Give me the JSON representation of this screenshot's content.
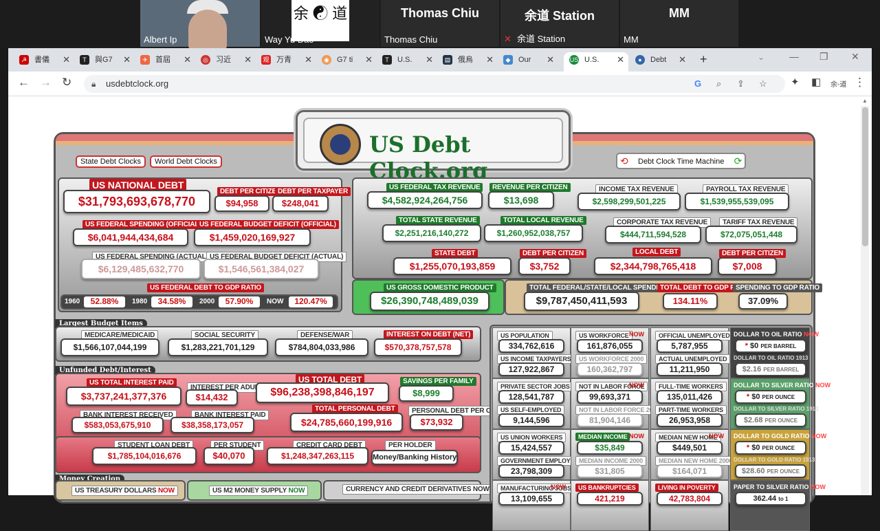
{
  "meeting": {
    "tiles": [
      {
        "name": "Albert Ip",
        "big": ""
      },
      {
        "name": "Way Yu Dao",
        "big": "余 ☯ 道"
      },
      {
        "name": "Thomas Chiu",
        "big": "Thomas Chiu"
      },
      {
        "name": "余道 Station",
        "big": "余道 Station"
      },
      {
        "name": "MM",
        "big": "MM"
      }
    ]
  },
  "browser": {
    "tabs": [
      "書儀",
      "與G7",
      "首屆",
      "习近",
      "万青",
      "G7 ti",
      "U.S.",
      "俄烏",
      "Our",
      "U.S.",
      "Debt"
    ],
    "url": "usdebtclock.org"
  },
  "brand": "US Debt Clock.org",
  "buttons": {
    "state": "State Debt Clocks",
    "world": "World Debt Clocks",
    "time_machine": "Debt Clock Time Machine"
  },
  "national": {
    "title": "US NATIONAL DEBT",
    "value": "$31,793,693,678,770",
    "per_citizen_label": "DEBT PER CITIZEN",
    "per_citizen": "$94,958",
    "per_taxpayer_label": "DEBT PER TAXPAYER",
    "per_taxpayer": "$248,041",
    "spend_off_label": "US FEDERAL SPENDING (OFFICIAL)",
    "spend_off": "$6,041,944,434,684",
    "deficit_off_label": "US FEDERAL BUDGET DEFICIT (OFFICIAL)",
    "deficit_off": "$1,459,020,169,927",
    "spend_act_label": "US FEDERAL SPENDING (ACTUAL)",
    "spend_act": "$6,129,485,632,770",
    "deficit_act_label": "US FEDERAL BUDGET DEFICIT (ACTUAL)",
    "deficit_act": "$1,546,561,384,027",
    "gdp_ratio_label": "US FEDERAL DEBT TO GDP RATIO",
    "years": [
      {
        "y": "1960",
        "v": "52.88%"
      },
      {
        "y": "1980",
        "v": "34.58%"
      },
      {
        "y": "2000",
        "v": "57.90%"
      },
      {
        "y": "NOW",
        "v": "120.47%"
      }
    ]
  },
  "revenue": {
    "fed_label": "US FEDERAL TAX REVENUE",
    "fed": "$4,582,924,264,756",
    "rpc_label": "REVENUE PER CITIZEN",
    "rpc": "$13,698",
    "income_label": "INCOME TAX REVENUE",
    "income": "$2,598,299,501,225",
    "payroll_label": "PAYROLL TAX REVENUE",
    "payroll": "$1,539,955,539,095",
    "state_label": "TOTAL STATE REVENUE",
    "state": "$2,251,216,140,272",
    "local_label": "TOTAL LOCAL REVENUE",
    "local": "$1,260,952,038,757",
    "corp_label": "CORPORATE TAX REVENUE",
    "corp": "$444,711,594,528",
    "tariff_label": "TARIFF TAX REVENUE",
    "tariff": "$72,075,051,448",
    "sdebt_label": "STATE DEBT",
    "sdebt": "$1,255,070,193,859",
    "sdpc_label": "DEBT PER CITIZEN",
    "sdpc": "$3,752",
    "ldebt_label": "LOCAL DEBT",
    "ldebt": "$2,344,798,765,418",
    "ldpc_label": "DEBT PER CITIZEN",
    "ldpc": "$7,008",
    "gdp_label": "US GROSS DOMESTIC PRODUCT",
    "gdp": "$26,390,748,489,039",
    "tot_label": "TOTAL FEDERAL/STATE/LOCAL SPENDING",
    "tot": "$9,787,450,411,593",
    "dgdp_label": "TOTAL DEBT TO GDP RATIO",
    "dgdp": "134.11%",
    "sgdp_label": "SPENDING TO GDP RATIO",
    "sgdp": "37.09%"
  },
  "budget": {
    "title": "Largest Budget Items",
    "items": [
      {
        "l": "MEDICARE/MEDICAID",
        "v": "$1,566,107,044,199"
      },
      {
        "l": "SOCIAL SECURITY",
        "v": "$1,283,221,701,129"
      },
      {
        "l": "DEFENSE/WAR",
        "v": "$784,804,033,986"
      },
      {
        "l": "INTEREST ON DEBT (NET)",
        "v": "$570,378,757,578"
      }
    ]
  },
  "unfunded": {
    "title": "Unfunded Debt/Interest",
    "interest_paid_label": "US TOTAL INTEREST PAID",
    "interest_paid": "$3,737,241,377,376",
    "ipa_label": "INTEREST PER ADULT",
    "ipa": "$14,432",
    "total_debt_label": "US TOTAL DEBT",
    "total_debt": "$96,238,398,846,197",
    "savings_label": "SAVINGS PER FAMILY",
    "savings": "$8,999",
    "bir_label": "BANK INTEREST RECEIVED",
    "bir": "$583,053,675,910",
    "bip_label": "BANK INTEREST PAID",
    "bip": "$38,358,173,057",
    "tpd_label": "TOTAL PERSONAL DEBT",
    "tpd": "$24,785,660,199,916",
    "pdpc_label": "PERSONAL DEBT PER CIT.",
    "pdpc": "$73,932",
    "sld_label": "STUDENT LOAN DEBT",
    "sld": "$1,785,104,016,676",
    "ps_label": "PER STUDENT",
    "ps": "$40,070",
    "ccd_label": "CREDIT CARD DEBT",
    "ccd": "$1,248,347,263,115",
    "ph_label": "PER HOLDER",
    "ph": "Money/Banking History"
  },
  "money": {
    "title": "Money Creation",
    "l1": "US TREASURY DOLLARS",
    "l1b": "NOW",
    "l2": "US M2 MONEY SUPPLY",
    "l2b": "NOW",
    "l3": "CURRENCY AND CREDIT DERIVATIVES NOW"
  },
  "grid": [
    {
      "a": "US POPULATION",
      "av": "334,762,616",
      "b": "US INCOME TAXPAYERS",
      "bv": "127,922,867"
    },
    {
      "a": "US WORKFORCE",
      "an": "NOW",
      "av": "161,876,055",
      "b": "US WORKFORCE 2000",
      "bv": "160,362,797"
    },
    {
      "a": "OFFICIAL UNEMPLOYED",
      "av": "5,787,955",
      "b": "ACTUAL UNEMPLOYED",
      "bv": "11,211,950"
    },
    {
      "a": "PRIVATE SECTOR JOBS",
      "av": "128,541,787",
      "b": "US SELF-EMPLOYED",
      "bv": "9,144,596"
    },
    {
      "a": "NOT IN LABOR FORCE",
      "an": "NOW",
      "av": "99,693,371",
      "b": "NOT IN LABOR FORCE 2000",
      "bv": "81,904,146"
    },
    {
      "a": "FULL-TIME WORKERS",
      "av": "135,011,426",
      "b": "PART-TIME WORKERS",
      "bv": "26,953,958"
    },
    {
      "a": "US UNION WORKERS",
      "av": "15,424,557",
      "b": "GOVERNMENT EMPLOYEES",
      "bv": "23,798,309"
    },
    {
      "a": "MEDIAN INCOME",
      "an": "NOW",
      "av": "$35,849",
      "b": "MEDIAN INCOME 2000",
      "bv": "$31,805"
    },
    {
      "a": "MEDIAN NEW HOME",
      "an": "NOW",
      "av": "$449,501",
      "b": "MEDIAN NEW HOME 2000",
      "bv": "$164,071"
    },
    {
      "a": "MANUFACTURING JOBS",
      "an": "NOW",
      "av": "13,109,655"
    },
    {
      "a": "US BANKRUPTCIES",
      "av": "421,219"
    },
    {
      "a": "LIVING IN POVERTY",
      "av": "42,783,804"
    }
  ],
  "ratios": [
    {
      "l": "DOLLAR TO OIL RATIO",
      "n": "NOW",
      "v": "$0",
      "u": "PER BARREL",
      "l2": "DOLLAR TO OIL RATIO 1913",
      "v2": "$2.16",
      "u2": "PER BARREL"
    },
    {
      "l": "DOLLAR TO SILVER RATIO",
      "n": "NOW",
      "v": "$0",
      "u": "PER OUNCE",
      "l2": "DOLLAR TO SILVER RATIO 1913",
      "v2": "$2.68",
      "u2": "PER OUNCE"
    },
    {
      "l": "DOLLAR TO GOLD RATIO",
      "n": "NOW",
      "v": "$0",
      "u": "PER OUNCE",
      "l2": "DOLLAR TO GOLD RATIO 1913",
      "v2": "$28.60",
      "u2": "PER OUNCE"
    },
    {
      "l": "PAPER TO SILVER RATIO",
      "n": "NOW",
      "v": "362.44",
      "u": "to 1"
    }
  ]
}
